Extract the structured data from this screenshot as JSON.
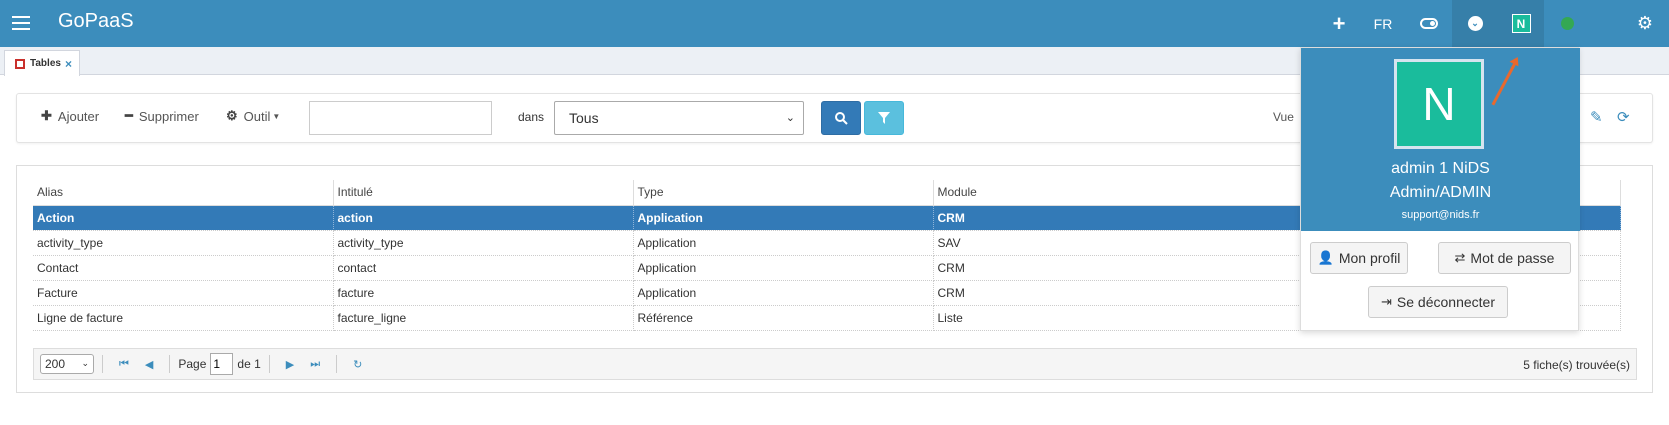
{
  "app": {
    "brand": "GoPaaS"
  },
  "topbar": {
    "lang": "FR",
    "avatar_initial": "N"
  },
  "tabs": [
    {
      "label": "Tables",
      "close": "×"
    }
  ],
  "toolbar": {
    "add_label": "Ajouter",
    "delete_label": "Supprimer",
    "tool_label": "Outil",
    "search_value": "",
    "dans_label": "dans",
    "scope_select": "Tous",
    "view_label": "Vue"
  },
  "table": {
    "columns": [
      "Alias",
      "Intitulé",
      "Type",
      "Module"
    ],
    "rows": [
      [
        "Action",
        "action",
        "Application",
        "CRM"
      ],
      [
        "activity_type",
        "activity_type",
        "Application",
        "SAV"
      ],
      [
        "Contact",
        "contact",
        "Application",
        "CRM"
      ],
      [
        "Facture",
        "facture",
        "Application",
        "CRM"
      ],
      [
        "Ligne de facture",
        "facture_ligne",
        "Référence",
        "Liste"
      ]
    ],
    "selected_row": 0
  },
  "pager": {
    "page_size": "200",
    "page_label": "Page",
    "page_value": "1",
    "of_label": "de 1",
    "found_text": "5 fiche(s) trouvée(s)"
  },
  "user_menu": {
    "initial": "N",
    "name": "admin 1 NiDS",
    "role": "Admin/ADMIN",
    "email": "support@nids.fr",
    "profile_label": "Mon profil",
    "password_label": "Mot de passe",
    "logout_label": "Se déconnecter"
  },
  "colors": {
    "header": "#3c8dbc",
    "selected_row": "#337ab7",
    "avatar": "#1abc9c",
    "status": "#34a853",
    "annotation_arrow": "#e8692e"
  }
}
